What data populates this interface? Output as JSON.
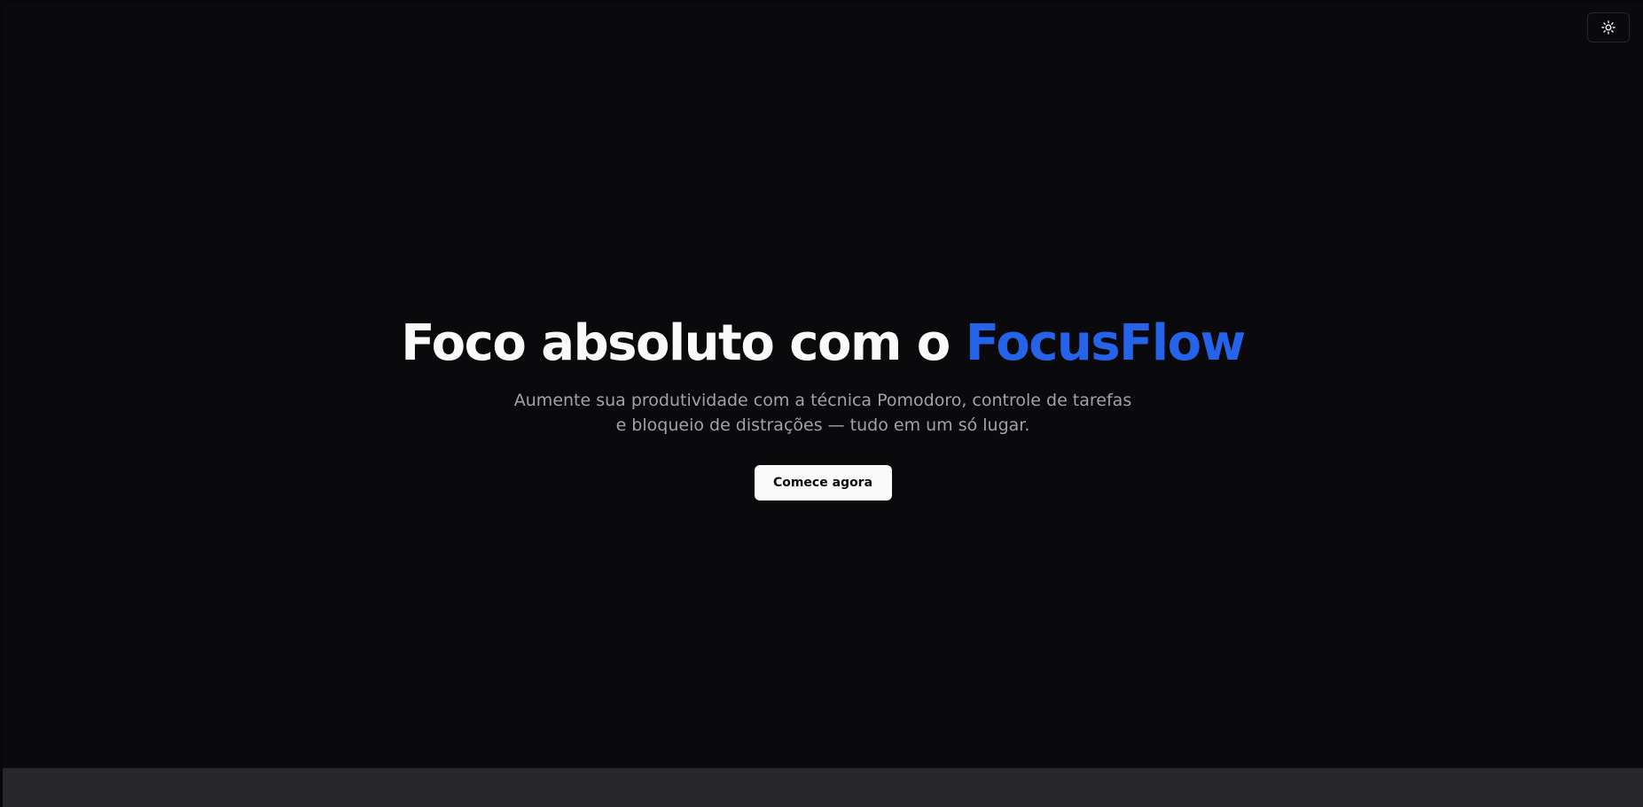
{
  "header": {
    "theme_toggle_icon": "sun-icon"
  },
  "hero": {
    "title_prefix": "Foco absoluto com o ",
    "title_brand": "FocusFlow",
    "subtitle": "Aumente sua produtividade com a técnica Pomodoro, controle de tarefas e bloqueio de distrações — tudo em um só lugar.",
    "cta_label": "Comece agora"
  },
  "colors": {
    "background": "#0a0a0d",
    "accent": "#2563eb",
    "text_primary": "#fafafa",
    "text_muted": "#a1a1aa",
    "footer_band": "#27272a"
  }
}
